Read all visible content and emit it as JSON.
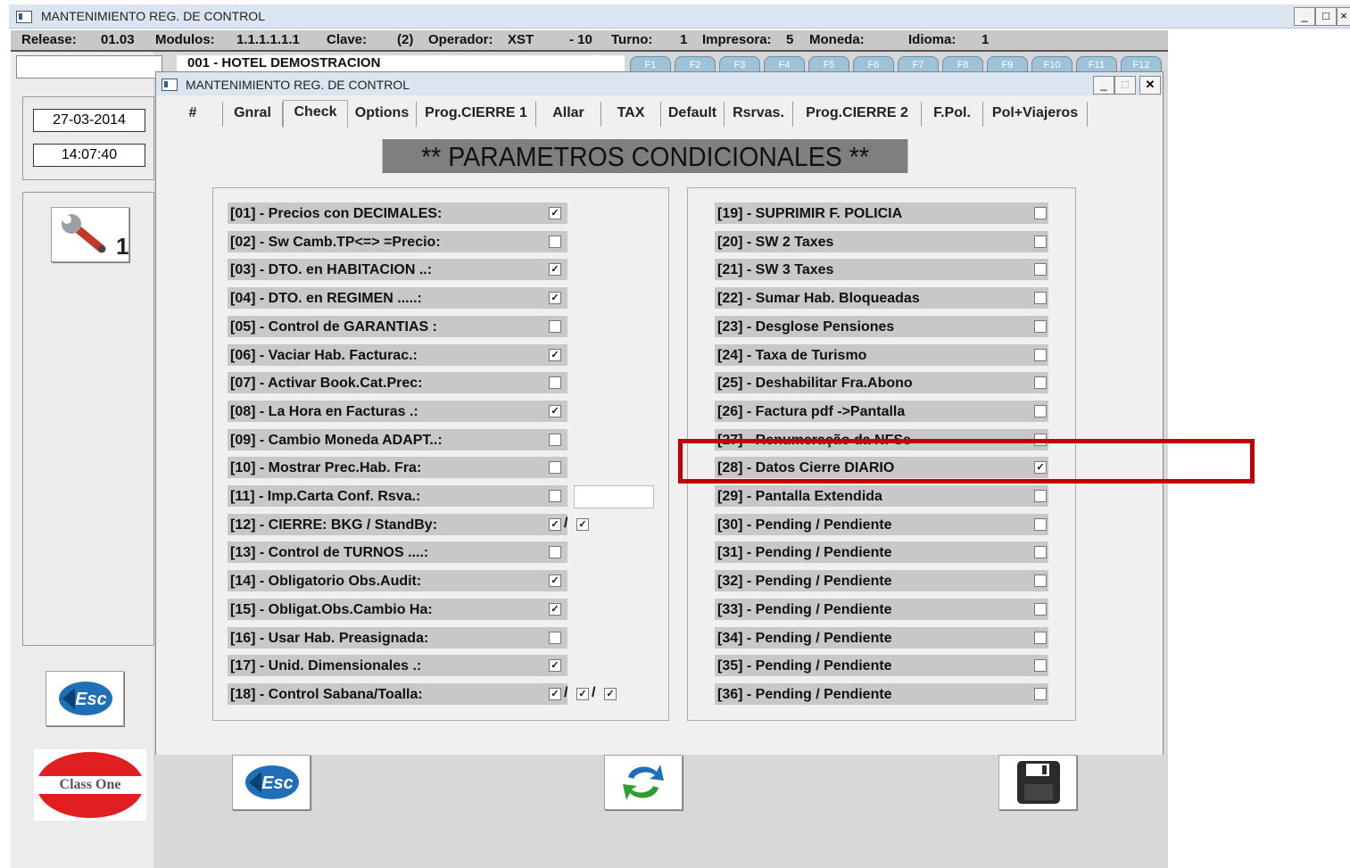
{
  "outer_window": {
    "title": "MANTENIMIENTO REG. DE  CONTROL",
    "controls": {
      "minimize": "_",
      "maximize": "□",
      "close": "×"
    }
  },
  "infobar": {
    "release_label": "Release:",
    "release": "01.03",
    "modulos_label": "Modulos:",
    "modulos": "1.1.1.1.1.1",
    "clave_label": "Clave:",
    "clave": "(2)",
    "operador_label": "Operador:",
    "operador": "XST",
    "operador_code": "- 10",
    "turno_label": "Turno:",
    "turno": "1",
    "impresora_label": "Impresora:",
    "impresora": "5",
    "moneda_label": "Moneda:",
    "idioma_label": "Idioma:",
    "idioma": "1"
  },
  "hotel": "001 - HOTEL DEMOSTRACION",
  "function_keys": [
    "F1",
    "F2",
    "F3",
    "F4",
    "F5",
    "F6",
    "F7",
    "F8",
    "F9",
    "F10",
    "F11",
    "F12"
  ],
  "left_panel": {
    "date": "27-03-2014",
    "time": "14:07:40",
    "tool_badge": "1",
    "class_one_logo": "Class One"
  },
  "inner_window": {
    "title": "MANTENIMIENTO REG. DE  CONTROL",
    "controls": {
      "minimize": "_",
      "maximize": "□",
      "close": "✕"
    }
  },
  "tabs": [
    {
      "label": "#"
    },
    {
      "label": "Gnral"
    },
    {
      "label": "Check",
      "active": true
    },
    {
      "label": "Options"
    },
    {
      "label": "Prog.CIERRE 1"
    },
    {
      "label": "Allar"
    },
    {
      "label": "TAX"
    },
    {
      "label": "Default"
    },
    {
      "label": "Rsrvas."
    },
    {
      "label": "Prog.CIERRE 2"
    },
    {
      "label": "F.Pol."
    },
    {
      "label": "Pol+Viajeros"
    }
  ],
  "heading": "** PARAMETROS CONDICIONALES **",
  "left_params": [
    {
      "label": "[01] - Precios con DECIMALES:",
      "checks": [
        true
      ]
    },
    {
      "label": "[02] - Sw Camb.TP<=> =Precio:",
      "checks": [
        false
      ]
    },
    {
      "label": "[03] - DTO. en HABITACION ..:",
      "checks": [
        true
      ]
    },
    {
      "label": "[04] - DTO. en REGIMEN .....:",
      "checks": [
        true
      ]
    },
    {
      "label": "[05] - Control de GARANTIAS :",
      "checks": [
        false
      ]
    },
    {
      "label": "[06] - Vaciar Hab. Facturac.:",
      "checks": [
        true
      ]
    },
    {
      "label": "[07] - Activar Book.Cat.Prec:",
      "checks": [
        false
      ]
    },
    {
      "label": "[08] - La Hora en Facturas .:",
      "checks": [
        true
      ]
    },
    {
      "label": "[09] - Cambio Moneda ADAPT..:",
      "checks": [
        false
      ]
    },
    {
      "label": "[10] - Mostrar Prec.Hab. Fra:",
      "checks": [
        false
      ]
    },
    {
      "label": "[11] - Imp.Carta Conf. Rsva.:",
      "checks": [
        false
      ],
      "has_input": true
    },
    {
      "label": "[12] - CIERRE: BKG / StandBy:",
      "checks": [
        true,
        true
      ]
    },
    {
      "label": "[13] - Control de TURNOS ....:",
      "checks": [
        false
      ]
    },
    {
      "label": "[14] - Obligatorio Obs.Audit:",
      "checks": [
        true
      ]
    },
    {
      "label": "[15] - Obligat.Obs.Cambio Ha:",
      "checks": [
        true
      ]
    },
    {
      "label": "[16] - Usar Hab. Preasignada:",
      "checks": [
        false
      ]
    },
    {
      "label": "[17] - Unid. Dimensionales .:",
      "checks": [
        true
      ]
    },
    {
      "label": "[18] - Control Sabana/Toalla:",
      "checks": [
        true,
        true,
        true
      ]
    }
  ],
  "right_params": [
    {
      "label": "[19] - SUPRIMIR F. POLICIA",
      "checked": false
    },
    {
      "label": "[20] - SW 2 Taxes",
      "checked": false
    },
    {
      "label": "[21] - SW 3 Taxes",
      "checked": false
    },
    {
      "label": "[22] - Sumar Hab. Bloqueadas",
      "checked": false
    },
    {
      "label": "[23] - Desglose Pensiones",
      "checked": false
    },
    {
      "label": "[24] - Taxa de Turismo",
      "checked": false
    },
    {
      "label": "[25] - Deshabilitar Fra.Abono",
      "checked": false
    },
    {
      "label": "[26] - Factura pdf ->Pantalla",
      "checked": false
    },
    {
      "label": "[27] - Renumeração da NFSe",
      "checked": false
    },
    {
      "label": "[28] - Datos Cierre DIARIO",
      "checked": true,
      "highlighted": true
    },
    {
      "label": "[29] - Pantalla Extendida",
      "checked": false
    },
    {
      "label": "[30] - Pending / Pendiente",
      "checked": false
    },
    {
      "label": "[31] - Pending / Pendiente",
      "checked": false
    },
    {
      "label": "[32] - Pending / Pendiente",
      "checked": false
    },
    {
      "label": "[33] - Pending / Pendiente",
      "checked": false
    },
    {
      "label": "[34] - Pending / Pendiente",
      "checked": false
    },
    {
      "label": "[35] - Pending / Pendiente",
      "checked": false
    },
    {
      "label": "[36] - Pending / Pendiente",
      "checked": false
    }
  ],
  "separator": "/",
  "check_mark": "✓",
  "colors": {
    "highlight_border": "#c00000",
    "row_bg": "#c8c8c8",
    "heading_bg": "#7f7f7f",
    "title_bar": "#dbe5f1"
  },
  "icons": {
    "esc_button": "esc-icon",
    "refresh_button": "refresh-icon",
    "save_button": "floppy-disk-icon",
    "tool_button": "wrench-icon"
  }
}
